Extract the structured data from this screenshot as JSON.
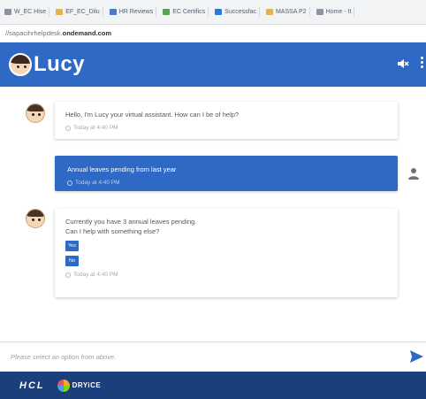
{
  "bookmarks": [
    {
      "label": "W_EC Hise",
      "icon": "page-icon",
      "color": "#8b95a1"
    },
    {
      "label": "EF_EC_Dilu",
      "icon": "folder-icon",
      "color": "#e0b54f"
    },
    {
      "label": "HR Reviews",
      "icon": "hr-icon",
      "color": "#4a7bd0"
    },
    {
      "label": "EC Certifics",
      "icon": "doc-icon",
      "color": "#5aa05a"
    },
    {
      "label": "Successfac",
      "icon": "sf-icon",
      "color": "#2b7bd6"
    },
    {
      "label": "MASSA P2",
      "icon": "folder-icon",
      "color": "#e0b54f"
    },
    {
      "label": "Home - It",
      "icon": "page-icon",
      "color": "#8b95a1"
    }
  ],
  "url": {
    "prefix": "//sapacihrhelpdesk.",
    "host": "ondemand.com"
  },
  "header": {
    "logo_text": "Lucy",
    "mute_icon": "speaker-mute-icon",
    "menu_icon": "kebab-menu-icon"
  },
  "messages": {
    "greeting": {
      "text": "Hello, I'm Lucy your virtual assistant. How can I be of help?",
      "time": "Today at 4:40 PM"
    },
    "user_query": {
      "text": "Annual leaves pending from last year",
      "time": "Today at 4:40 PM"
    },
    "answer": {
      "line1": "Currently you have 3 annual leaves pending.",
      "line2": "Can I help with something else?",
      "yes_label": "Yes",
      "no_label": "No",
      "time": "Today at 4:40 PM"
    }
  },
  "input": {
    "placeholder": "Please select an option from above."
  },
  "footer": {
    "hcl_text": "HCL",
    "dryice_text": "DRYiCE"
  },
  "colors": {
    "brand_blue": "#2f69c6",
    "footer_navy": "#1b3f7d"
  }
}
